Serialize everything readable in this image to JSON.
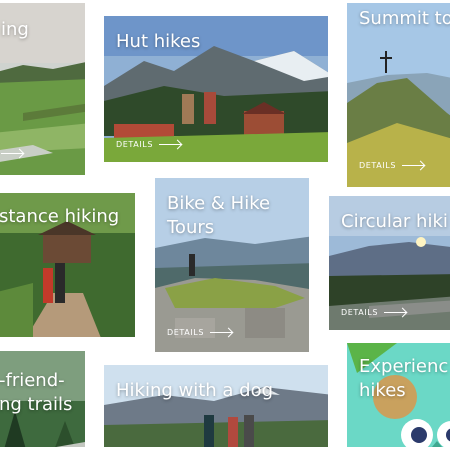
{
  "cards": [
    {
      "id": "c1",
      "title": "ing",
      "details": ""
    },
    {
      "id": "c2",
      "title": "Hut hikes",
      "details": "DETAILS"
    },
    {
      "id": "c3",
      "title": "Summit to",
      "details": "DETAILS"
    },
    {
      "id": "c4",
      "title": "stance hiking",
      "details": ""
    },
    {
      "id": "c5",
      "title_line1": "Bike & Hike",
      "title_line2": "Tours",
      "details": "DETAILS"
    },
    {
      "id": "c6",
      "title": "Circular hiki",
      "details": "DETAILS"
    },
    {
      "id": "c7",
      "title_line1": "-friend-",
      "title_line2": "ng trails",
      "details": ""
    },
    {
      "id": "c8",
      "title": "Hiking with a dog",
      "details": ""
    },
    {
      "id": "c9",
      "title_line1": "Experienc",
      "title_line2": "hikes",
      "details": ""
    }
  ],
  "colors": {
    "accent": "#c9a15e",
    "white": "#ffffff"
  }
}
